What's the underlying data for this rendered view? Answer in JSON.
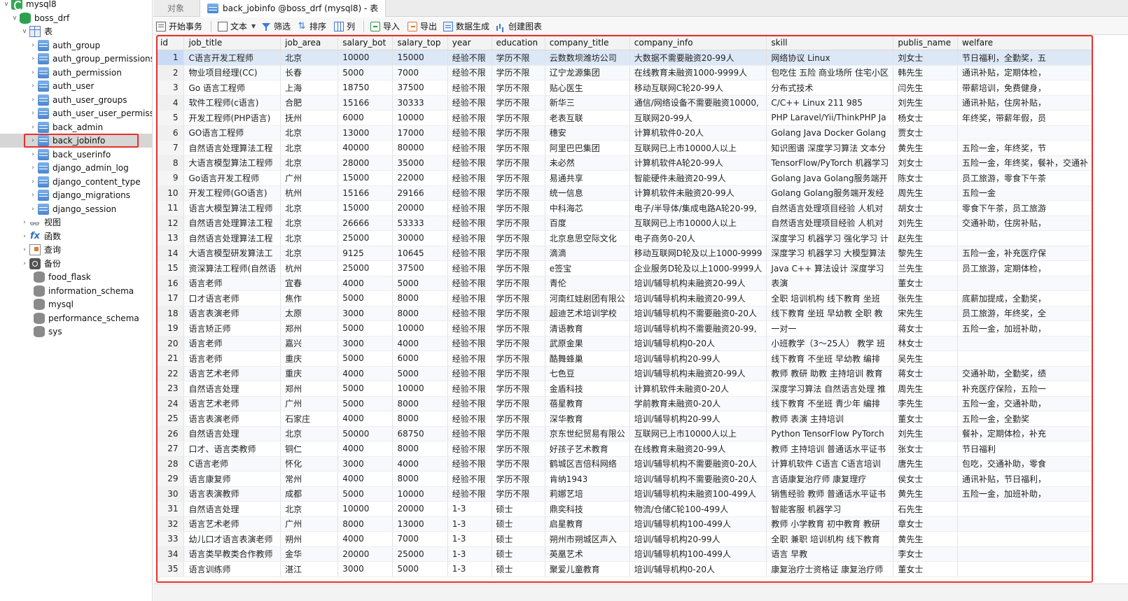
{
  "sidebar": {
    "connection": "mysql8",
    "database": "boss_drf",
    "tables_label": "表",
    "tables": [
      "auth_group",
      "auth_group_permissions",
      "auth_permission",
      "auth_user",
      "auth_user_groups",
      "auth_user_user_permissi",
      "back_admin",
      "back_jobinfo",
      "back_userinfo",
      "django_admin_log",
      "django_content_type",
      "django_migrations",
      "django_session"
    ],
    "selected_table": "back_jobinfo",
    "nodes": [
      "视图",
      "函数",
      "查询",
      "备份"
    ],
    "other_databases": [
      "food_flask",
      "information_schema",
      "mysql",
      "performance_schema",
      "sys"
    ],
    "colors": {
      "highlight": "#e8302c",
      "db": "#2e9e4f",
      "table": "#4a86d0"
    }
  },
  "tabs": {
    "objects": "对象",
    "active": "back_jobinfo @boss_drf (mysql8) - 表"
  },
  "toolbar": {
    "begin_transaction": "开始事务",
    "text": "文本",
    "filter": "筛选",
    "sort": "排序",
    "columns": "列",
    "import": "导入",
    "export": "导出",
    "data_generation": "数据生成",
    "create_chart": "创建图表"
  },
  "grid": {
    "columns": [
      "id",
      "job_title",
      "job_area",
      "salary_bot",
      "salary_top",
      "year",
      "education",
      "company_title",
      "company_info",
      "skill",
      "publis_name",
      "welfare"
    ],
    "rows": [
      [
        "1",
        "C语言开发工程师",
        "北京",
        "10000",
        "15000",
        "经验不限",
        "学历不限",
        "云数数坝潍坊公司",
        "大数据不需要融资20-99人",
        "网络协议 Linux",
        "刘女士",
        "节日福利，全勤奖，五"
      ],
      [
        "2",
        "物业项目经理(CC)",
        "长春",
        "5000",
        "7000",
        "经验不限",
        "学历不限",
        "辽宁龙源集团",
        "在线教育未融资1000-9999人",
        "包吃住 五险 商业场所 住宅小区",
        "韩先生",
        "通讯补贴，定期体检，"
      ],
      [
        "3",
        "Go 语言工程师",
        "上海",
        "18750",
        "37500",
        "经验不限",
        "学历不限",
        "贴心医生",
        "移动互联网C轮20-99人",
        "分布式技术",
        "闫先生",
        "带薪培训，免费健身，"
      ],
      [
        "4",
        "软件工程师(c语言)",
        "合肥",
        "15166",
        "30333",
        "经验不限",
        "学历不限",
        "新华三",
        "通信/网络设备不需要融资10000,",
        "C/C++ Linux 211 985",
        "刘先生",
        "通讯补贴，住房补贴，"
      ],
      [
        "5",
        "开发工程师(PHP语言)",
        "抚州",
        "6000",
        "10000",
        "经验不限",
        "学历不限",
        "老表互联",
        "互联网20-99人",
        "PHP Laravel/Yii/ThinkPHP Ja",
        "杨女士",
        "年终奖，带薪年假，员"
      ],
      [
        "6",
        "GO语言工程师",
        "北京",
        "13000",
        "17000",
        "经验不限",
        "学历不限",
        "穗安",
        "计算机软件0-20人",
        "Golang Java Docker Golang",
        "贾女士",
        ""
      ],
      [
        "7",
        "自然语言处理算法工程",
        "北京",
        "40000",
        "80000",
        "经验不限",
        "学历不限",
        "阿里巴巴集团",
        "互联网已上市10000人以上",
        "知识图谱 深度学习算法 文本分",
        "黄先生",
        "五险一金，年终奖，节"
      ],
      [
        "8",
        "大语言模型算法工程师",
        "北京",
        "28000",
        "35000",
        "经验不限",
        "学历不限",
        "未必然",
        "计算机软件A轮20-99人",
        "TensorFlow/PyTorch 机器学习",
        "刘女士",
        "五险一金，年终奖，餐补，交通补"
      ],
      [
        "9",
        "Go语言开发工程师",
        "广州",
        "15000",
        "22000",
        "经验不限",
        "学历不限",
        "易通共享",
        "智能硬件未融资20-99人",
        "Golang Java Golang服务端开",
        "陈女士",
        "员工旅游，零食下午茶"
      ],
      [
        "10",
        "开发工程师(GO语言)",
        "杭州",
        "15166",
        "29166",
        "经验不限",
        "学历不限",
        "统一信息",
        "计算机软件未融资20-99人",
        "Golang Golang服务端开发经",
        "周先生",
        "五险一金"
      ],
      [
        "11",
        "语言大模型算法工程师",
        "北京",
        "15000",
        "20000",
        "经验不限",
        "学历不限",
        "中科海芯",
        "电子/半导体/集成电路A轮20-99,",
        "自然语言处理项目经验 人机对",
        "胡女士",
        "零食下午茶，员工旅游"
      ],
      [
        "12",
        "自然语言处理算法工程",
        "北京",
        "26666",
        "53333",
        "经验不限",
        "学历不限",
        "百度",
        "互联网已上市10000人以上",
        "自然语言处理项目经验 人机对",
        "刘先生",
        "交通补助，住房补贴，"
      ],
      [
        "13",
        "自然语言处理算法工程",
        "北京",
        "25000",
        "30000",
        "经验不限",
        "学历不限",
        "北京息思空际文化",
        "电子商务0-20人",
        "深度学习 机器学习 强化学习 计",
        "赵先生",
        ""
      ],
      [
        "14",
        "大语言模型研发算法工",
        "北京",
        "9125",
        "10645",
        "经验不限",
        "学历不限",
        "滴滴",
        "移动互联网D轮及以上1000-9999",
        "深度学习 机器学习 大模型算法",
        "黎先生",
        "五险一金，补充医疗保"
      ],
      [
        "15",
        "资深算法工程师(自然语",
        "杭州",
        "25000",
        "37500",
        "经验不限",
        "学历不限",
        "e签宝",
        "企业服务D轮及以上1000-9999人",
        "Java C++ 算法设计 深度学习",
        "兰先生",
        "员工旅游，定期体检，"
      ],
      [
        "16",
        "语言老师",
        "宜春",
        "4000",
        "5000",
        "经验不限",
        "学历不限",
        "青伦",
        "培训/辅导机构未融资20-99人",
        "表演",
        "董女士",
        ""
      ],
      [
        "17",
        "口才语言老师",
        "焦作",
        "5000",
        "8000",
        "经验不限",
        "学历不限",
        "河南红娃剧团有限公",
        "培训/辅导机构未融资20-99人",
        "全职 培训机构 线下教育 坐班",
        "张先生",
        "底薪加提成，全勤奖，"
      ],
      [
        "18",
        "语言表演老师",
        "太原",
        "3000",
        "8000",
        "经验不限",
        "学历不限",
        "超迪艺术培训学校",
        "培训/辅导机构不需要融资0-20人",
        "线下教育 坐班 早幼教 全职 教",
        "宋先生",
        "员工旅游，年终奖，全"
      ],
      [
        "19",
        "语言矫正师",
        "郑州",
        "5000",
        "10000",
        "经验不限",
        "学历不限",
        "清语教育",
        "培训/辅导机构不需要融资20-99,",
        "一对一",
        "蒋女士",
        "五险一金，加班补助，"
      ],
      [
        "20",
        "语言老师",
        "嘉兴",
        "3000",
        "4000",
        "经验不限",
        "学历不限",
        "武原金果",
        "培训/辅导机构0-20人",
        "小班教学（3～25人） 教学 班",
        "林女士",
        ""
      ],
      [
        "21",
        "语言老师",
        "重庆",
        "5000",
        "6000",
        "经验不限",
        "学历不限",
        "酷舞蜂巢",
        "培训/辅导机构20-99人",
        "线下教育 不坐班 早幼教 编排",
        "吴先生",
        ""
      ],
      [
        "22",
        "语言艺术老师",
        "重庆",
        "4000",
        "5000",
        "经验不限",
        "学历不限",
        "七色豆",
        "培训/辅导机构未融资20-99人",
        "教师 教研 助教 主持培训 教育",
        "蒋女士",
        "交通补助，全勤奖，绩"
      ],
      [
        "23",
        "自然语言处理",
        "郑州",
        "5000",
        "10000",
        "经验不限",
        "学历不限",
        "金盾科技",
        "计算机软件未融资0-20人",
        "深度学习算法 自然语言处理 推",
        "周先生",
        "补充医疗保险，五险一"
      ],
      [
        "24",
        "语言艺术老师",
        "广州",
        "5000",
        "8000",
        "经验不限",
        "学历不限",
        "蓓星教育",
        "学前教育未融资0-20人",
        "线下教育 不坐班 青少年 编排",
        "李先生",
        "五险一金，交通补助，"
      ],
      [
        "25",
        "语言表演老师",
        "石家庄",
        "4000",
        "8000",
        "经验不限",
        "学历不限",
        "深华教育",
        "培训/辅导机构20-99人",
        "教师 表演 主持培训",
        "董女士",
        "五险一金，全勤奖"
      ],
      [
        "26",
        "自然语言处理",
        "北京",
        "50000",
        "68750",
        "经验不限",
        "学历不限",
        "京东世纪贸易有限公",
        "互联网已上市10000人以上",
        "Python TensorFlow PyTorch",
        "刘先生",
        "餐补，定期体检，补充"
      ],
      [
        "27",
        "口才、语言类教师",
        "铜仁",
        "4000",
        "8000",
        "经验不限",
        "学历不限",
        "好孩子艺术教育",
        "在线教育未融资20-99人",
        "教师 主持培训 普通话水平证书",
        "张女士",
        "节日福利"
      ],
      [
        "28",
        "C语言老师",
        "怀化",
        "3000",
        "4000",
        "经验不限",
        "学历不限",
        "鹤城区吉倍科网络",
        "培训/辅导机构不需要融资0-20人",
        "计算机软件 C语言 C语言培训",
        "唐先生",
        "包吃，交通补助，零食"
      ],
      [
        "29",
        "语言康复师",
        "常州",
        "4000",
        "8000",
        "经验不限",
        "学历不限",
        "肯纳1943",
        "培训/辅导机构不需要融资0-20人",
        "言语康复治疗师 康复理疗",
        "侯女士",
        "通讯补贴，节日福利，"
      ],
      [
        "30",
        "语言表演教师",
        "成都",
        "5000",
        "10000",
        "经验不限",
        "学历不限",
        "莉娜艺培",
        "培训/辅导机构未融资100-499人",
        "销售经验 教师 普通话水平证书",
        "黄先生",
        "五险一金，加班补助，"
      ],
      [
        "31",
        "自然语言处理",
        "北京",
        "10000",
        "20000",
        "1-3",
        "硕士",
        "鼎奕科技",
        "物流/仓储C轮100-499人",
        "智能客服 机器学习",
        "石先生",
        ""
      ],
      [
        "32",
        "语言艺术老师",
        "广州",
        "8000",
        "13000",
        "1-3",
        "硕士",
        "启星教育",
        "培训/辅导机构100-499人",
        "教师 小学教育 初中教育 教研",
        "章女士",
        ""
      ],
      [
        "33",
        "幼儿口才语言表演老师",
        "朔州",
        "4000",
        "7000",
        "1-3",
        "硕士",
        "朔州市朔城区声入",
        "培训/辅导机构20-99人",
        "全职 兼职 培训机构 线下教育",
        "黄先生",
        ""
      ],
      [
        "34",
        "语言类早教类合作教师",
        "金华",
        "20000",
        "25000",
        "1-3",
        "硕士",
        "英凰艺术",
        "培训/辅导机构100-499人",
        "语言 早教",
        "李女士",
        ""
      ],
      [
        "35",
        "语言训练师",
        "湛江",
        "3000",
        "5000",
        "1-3",
        "硕士",
        "聚爱儿童教育",
        "培训/辅导机构0-20人",
        "康复治疗士资格证 康复治疗师",
        "董女士",
        ""
      ]
    ]
  }
}
